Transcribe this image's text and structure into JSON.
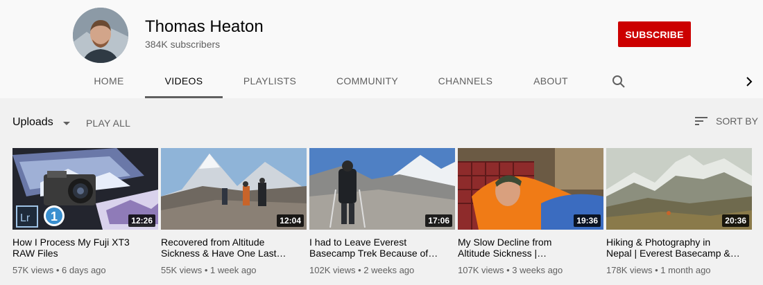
{
  "channel": {
    "name": "Thomas Heaton",
    "subscribers": "384K subscribers",
    "subscribe_label": "SUBSCRIBE"
  },
  "tabs": [
    {
      "label": "HOME"
    },
    {
      "label": "VIDEOS",
      "active": true
    },
    {
      "label": "PLAYLISTS"
    },
    {
      "label": "COMMUNITY"
    },
    {
      "label": "CHANNELS"
    },
    {
      "label": "ABOUT"
    }
  ],
  "icons": {
    "search": "search-icon",
    "next": "chevron-right-icon",
    "sort": "sort-icon",
    "dropdown": "caret-down-icon"
  },
  "filter": {
    "uploads_label": "Uploads",
    "play_all_label": "PLAY ALL",
    "sort_label": "SORT BY"
  },
  "colors": {
    "subscribe": "#cc0000",
    "background": "#f1f1f1",
    "header": "#f9f9f9"
  },
  "videos": [
    {
      "title": "How I Process My Fuji XT3\nRAW Files",
      "duration": "12:26",
      "views": "57K views",
      "age": "6 days ago"
    },
    {
      "title": "Recovered from Altitude\nSickness & Have One Last…",
      "duration": "12:04",
      "views": "55K views",
      "age": "1 week ago"
    },
    {
      "title": "I had to Leave Everest\nBasecamp Trek Because of…",
      "duration": "17:06",
      "views": "102K views",
      "age": "2 weeks ago"
    },
    {
      "title": "My Slow Decline from\nAltitude Sickness |…",
      "duration": "19:36",
      "views": "107K views",
      "age": "3 weeks ago"
    },
    {
      "title": "Hiking & Photography in\nNepal | Everest Basecamp &…",
      "duration": "20:36",
      "views": "178K views",
      "age": "1 month ago"
    }
  ]
}
